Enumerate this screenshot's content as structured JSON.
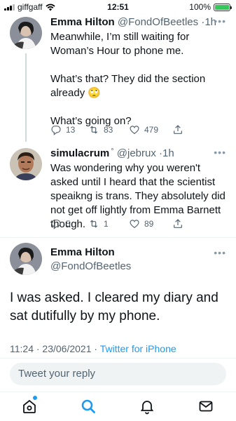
{
  "status_bar": {
    "carrier": "giffgaff",
    "time": "12:51",
    "battery": "100%",
    "battery_level": 1.0
  },
  "tweets": [
    {
      "name": "Emma Hilton",
      "handle": "@FondOfBeetles",
      "dot": "·",
      "time": "1h",
      "text": "Meanwhile, I’m still waiting for Woman’s Hour to phone me.\n\nWhat’s that? They did the section already 🙄\n\nWhat’s going on?",
      "replies": "13",
      "retweets": "83",
      "likes": "479"
    },
    {
      "name": "simulacrum",
      "handle": "@jebrux",
      "dot": "·",
      "time": "1h",
      "text": "Was wondering why you weren't asked until I heard that the scientist speaikng is trans. They absolutely did not get off lightly from Emma Barnett though.",
      "replies": "5",
      "retweets": "1",
      "likes": "89"
    }
  ],
  "main_tweet": {
    "name": "Emma Hilton",
    "handle": "@FondOfBeetles",
    "text": "I was asked. I cleared my diary and sat dutifully by my phone.",
    "timestamp": "11:24 · 23/06/2021 · ",
    "source": "Twitter for iPhone"
  },
  "reply_placeholder": "Tweet your reply",
  "colors": {
    "accent": "#1d9bf0",
    "text": "#0f1419",
    "muted": "#536471"
  },
  "nav": [
    "home-icon",
    "search-icon",
    "notifications-icon",
    "messages-icon"
  ]
}
